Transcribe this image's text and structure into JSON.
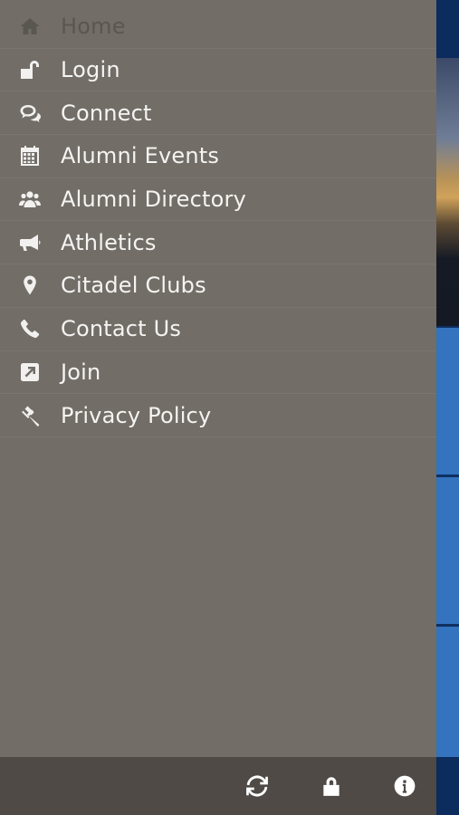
{
  "menu": {
    "items": [
      {
        "label": "Home",
        "icon": "home-icon"
      },
      {
        "label": "Login",
        "icon": "unlock-icon"
      },
      {
        "label": "Connect",
        "icon": "chat-bubbles-icon"
      },
      {
        "label": "Alumni Events",
        "icon": "calendar-icon"
      },
      {
        "label": "Alumni Directory",
        "icon": "group-icon"
      },
      {
        "label": "Athletics",
        "icon": "megaphone-icon"
      },
      {
        "label": "Citadel Clubs",
        "icon": "map-pin-icon"
      },
      {
        "label": "Contact Us",
        "icon": "phone-icon"
      },
      {
        "label": "Join",
        "icon": "external-link-square-icon"
      },
      {
        "label": "Privacy Policy",
        "icon": "gavel-icon"
      }
    ]
  },
  "footer": {
    "buttons": [
      "refresh-icon",
      "lock-icon",
      "info-icon"
    ]
  },
  "colors": {
    "drawer_bg": "#726d67",
    "footer_bg": "#4f4a45",
    "text": "#f5f4f2",
    "disabled_text": "#5a5652",
    "accent_blue": "#3473be"
  }
}
